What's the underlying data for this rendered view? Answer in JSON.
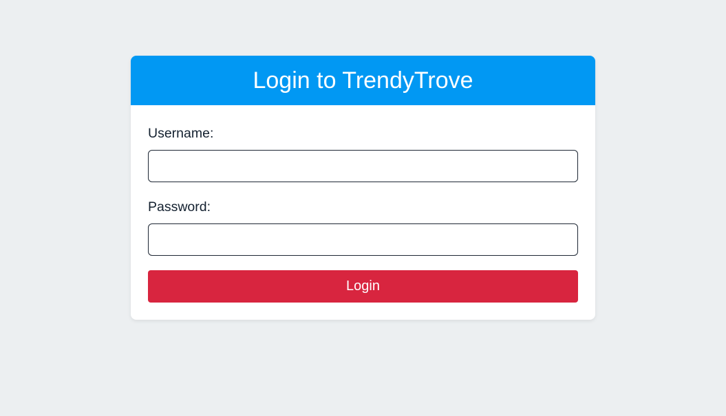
{
  "login_card": {
    "title": "Login to TrendyTrove",
    "header_color": "#0198f3",
    "username_label": "Username:",
    "username_value": "",
    "password_label": "Password:",
    "password_value": "",
    "login_button_label": "Login",
    "login_button_color": "#d8253f"
  }
}
